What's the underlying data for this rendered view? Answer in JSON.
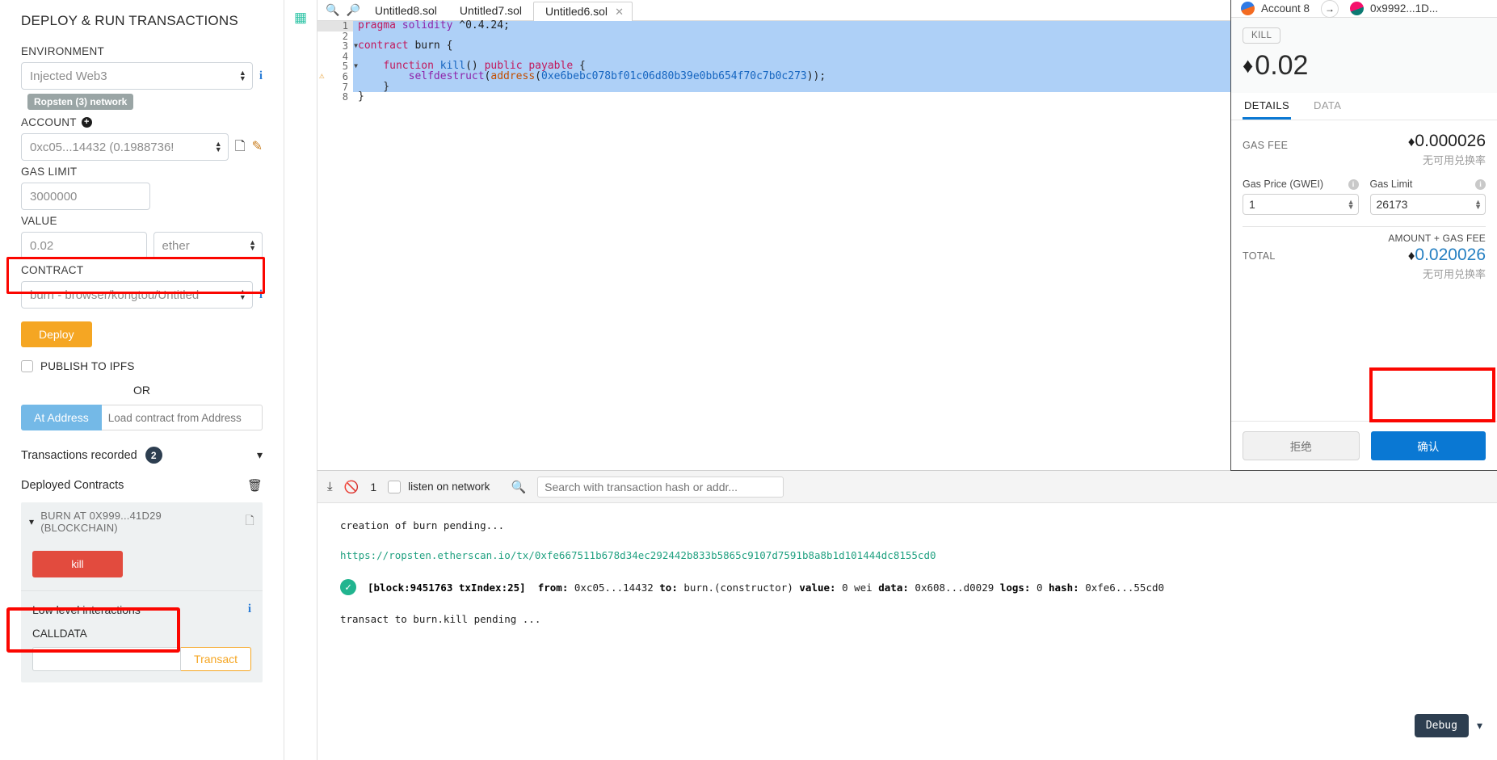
{
  "sidebar": {
    "title": "DEPLOY & RUN TRANSACTIONS",
    "environment_label": "ENVIRONMENT",
    "environment_value": "Injected Web3",
    "network_badge": "Ropsten (3) network",
    "account_label": "ACCOUNT",
    "account_value": "0xc05...14432 (0.1988736!",
    "gas_limit_label": "GAS LIMIT",
    "gas_limit_value": "3000000",
    "value_label": "VALUE",
    "value_amount": "0.02",
    "value_unit": "ether",
    "contract_label": "CONTRACT",
    "contract_value": "burn - browser/kongtou/Untitled",
    "deploy_label": "Deploy",
    "publish_ipfs_label": "PUBLISH TO IPFS",
    "or_label": "OR",
    "at_address_label": "At Address",
    "at_address_placeholder": "Load contract from Address",
    "transactions_recorded_label": "Transactions recorded",
    "transactions_recorded_count": "2",
    "deployed_contracts_label": "Deployed Contracts",
    "contract_instance": "BURN AT 0X999...41D29 (BLOCKCHAIN)",
    "kill_button": "kill",
    "low_level_label": "Low level interactions",
    "calldata_label": "CALLDATA",
    "calldata_value": "",
    "transact_label": "Transact"
  },
  "editor": {
    "tabs": [
      {
        "label": "Untitled8.sol",
        "active": false
      },
      {
        "label": "Untitled7.sol",
        "active": false
      },
      {
        "label": "Untitled6.sol",
        "active": true
      }
    ],
    "close_glyph": "✕",
    "zoom_out_icon": "zoom-out-icon",
    "zoom_in_icon": "zoom-in-icon",
    "lines": [
      {
        "n": "1",
        "text": "pragma solidity ^0.4.24;"
      },
      {
        "n": "2",
        "text": ""
      },
      {
        "n": "3",
        "text": "contract burn {"
      },
      {
        "n": "4",
        "text": ""
      },
      {
        "n": "5",
        "text": "    function kill() public payable {"
      },
      {
        "n": "6",
        "text": "        selfdestruct(address(0xe6bebc078bf01c06d80b39e0bb654f70c7b0c273));"
      },
      {
        "n": "7",
        "text": "    }"
      },
      {
        "n": "8",
        "text": "}"
      }
    ]
  },
  "terminal": {
    "collapse_icon": "chevrons-down-icon",
    "clear_icon": "ban-icon",
    "count": "1",
    "listen_label": "listen on network",
    "search_placeholder": "Search with transaction hash or addr...",
    "log_pending_creation": "creation of burn pending...",
    "log_link": "https://ropsten.etherscan.io/tx/0xfe667511b678d34ec292442b833b5865c9107d7591b8a8b1d101444dc8155cd0",
    "tx_block": "[block:9451763 txIndex:25]",
    "tx_from_label": "from:",
    "tx_from": "0xc05...14432",
    "tx_to_label": "to:",
    "tx_to": "burn.(constructor)",
    "tx_value_label": "value:",
    "tx_value": "0 wei",
    "tx_data_label": "data:",
    "tx_data": "0x608...d0029",
    "tx_logs_label": "logs:",
    "tx_logs": "0",
    "tx_hash_label": "hash:",
    "tx_hash": "0xfe6...55cd0",
    "log_pending_kill": "transact to burn.kill pending ...",
    "debug_label": "Debug"
  },
  "metamask": {
    "account_name": "Account 8",
    "recipient": "0x9992...1D...",
    "arrow_glyph": "→",
    "method_badge": "KILL",
    "amount": "0.02",
    "eth_glyph": "♦",
    "tabs": [
      {
        "label": "DETAILS",
        "active": true
      },
      {
        "label": "DATA",
        "active": false
      }
    ],
    "gas_fee_label": "GAS FEE",
    "gas_fee_amount": "0.000026",
    "no_conversion_rate": "无可用兑换率",
    "gas_price_label": "Gas Price (GWEI)",
    "gas_price_value": "1",
    "gas_limit_label": "Gas Limit",
    "gas_limit_value": "26173",
    "amount_gas_fee_label": "AMOUNT + GAS FEE",
    "total_label": "TOTAL",
    "total_amount": "0.020026",
    "reject_label": "拒绝",
    "confirm_label": "确认",
    "info_glyph": "i"
  },
  "colors": {
    "accent_orange": "#f5a623",
    "danger_red": "#e24b3e",
    "highlight_red": "#fb0600",
    "confirm_blue": "#0a78d3",
    "link_green": "#21a181",
    "at_address_blue": "#74b9e7"
  }
}
